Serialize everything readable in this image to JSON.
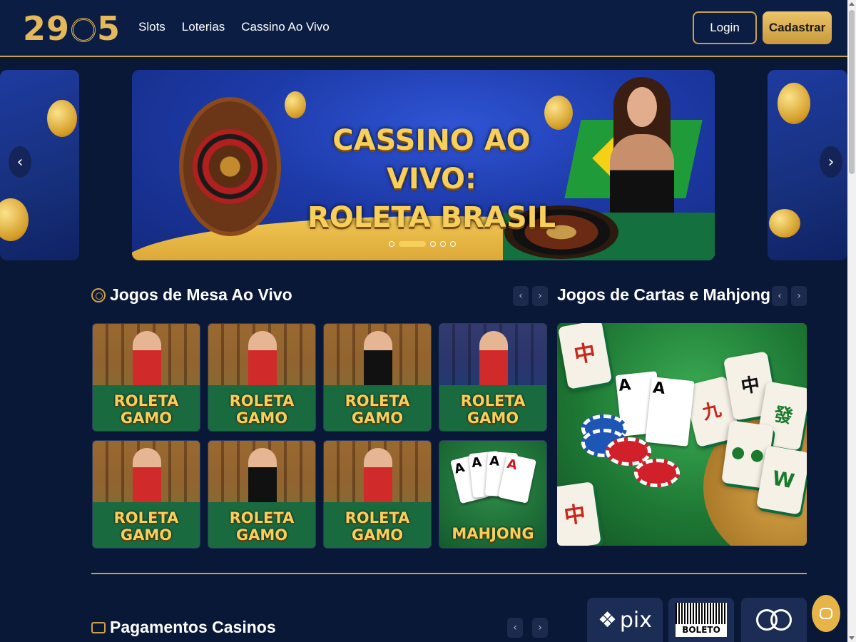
{
  "header": {
    "logo_text_left": "29",
    "logo_text_right": "5",
    "nav": [
      "Slots",
      "Loterias",
      "Cassino Ao Vivo"
    ],
    "login_label": "Login",
    "register_label": "Cadastrar"
  },
  "banner": {
    "title_line1": "CASSINO AO VIVO:",
    "title_line2": "ROLETA BRASIL",
    "prev_icon": "chevron-left-icon",
    "next_icon": "chevron-right-icon",
    "slide_count": 5,
    "active_slide": 1
  },
  "live_tables": {
    "title": "Jogos de Mesa Ao Vivo",
    "prev": "‹",
    "next": "›",
    "tiles": [
      {
        "line1": "ROLETA",
        "line2": "GAMO",
        "dealer": "woman"
      },
      {
        "line1": "ROLETA",
        "line2": "GAMO",
        "dealer": "woman"
      },
      {
        "line1": "ROLETA",
        "line2": "GAMO",
        "dealer": "man"
      },
      {
        "line1": "ROLETA",
        "line2": "GAMO",
        "dealer": "woman"
      },
      {
        "line1": "ROLETA",
        "line2": "GAMO",
        "dealer": "woman"
      },
      {
        "line1": "ROLETA",
        "line2": "GAMO",
        "dealer": "man"
      },
      {
        "line1": "ROLETA",
        "line2": "GAMO",
        "dealer": "woman"
      },
      {
        "line1": "MAHJONG",
        "line2": "",
        "dealer": "cards"
      }
    ]
  },
  "cards_mahjong": {
    "title": "Jogos de Cartas e Mahjong",
    "prev": "‹",
    "next": "›",
    "tile_glyphs": [
      "中",
      "九",
      "中",
      "發",
      "A",
      "A"
    ]
  },
  "payments": {
    "title": "Pagamentos Casinos",
    "prev": "‹",
    "next": "›",
    "logos": [
      "pix",
      "BOLETO"
    ]
  },
  "colors": {
    "gold": "#c9a14a",
    "bg": "#0a1838",
    "header_bg": "#0c1d44"
  }
}
